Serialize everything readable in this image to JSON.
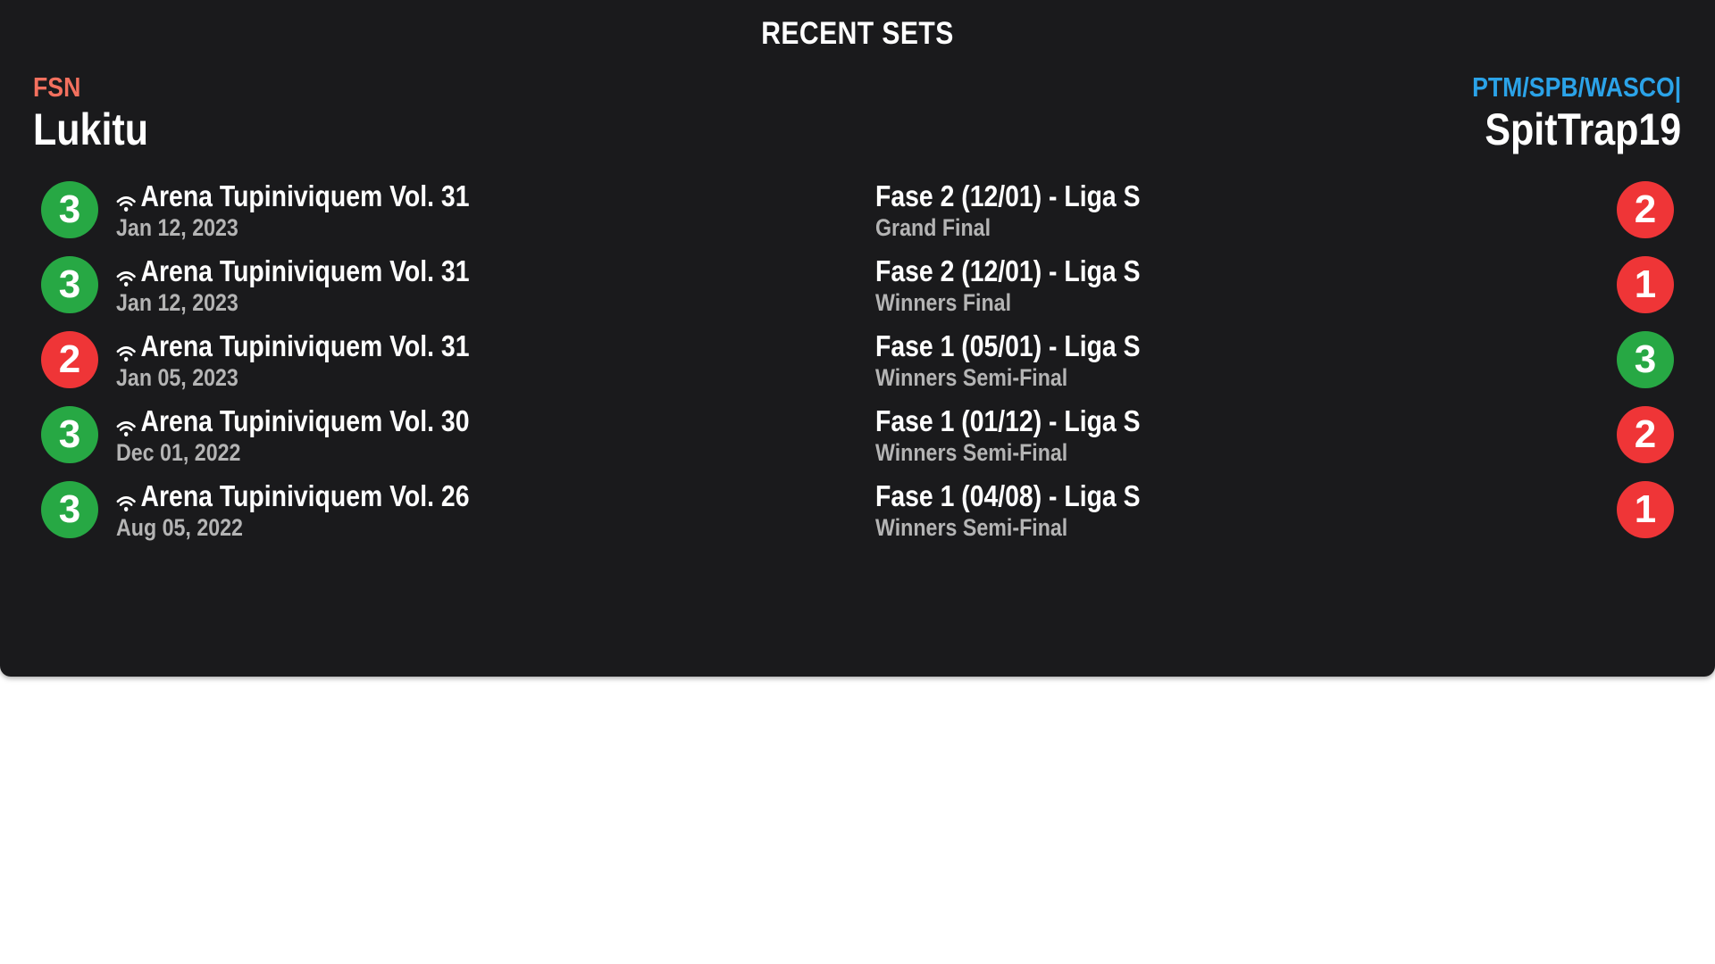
{
  "title": "RECENT SETS",
  "colors": {
    "background": "#1a1a1c",
    "win": "#27a844",
    "loss": "#ef3537",
    "left_sponsor": "#f3705e",
    "right_sponsor": "#2ba3e8",
    "subtext": "#b4b4b4"
  },
  "player_left": {
    "sponsor": "FSN",
    "name": "Lukitu"
  },
  "player_right": {
    "sponsor": "PTM/SPB/WASCO|",
    "name": "SpitTrap19"
  },
  "sets": [
    {
      "left_score": "3",
      "right_score": "2",
      "left_result": "win",
      "right_result": "loss",
      "online_icon": "wifi-icon",
      "tournament": "Arena Tupiniviquem Vol. 31",
      "date": "Jan 12, 2023",
      "event": "Fase 2 (12/01) - Liga S",
      "round": "Grand Final"
    },
    {
      "left_score": "3",
      "right_score": "1",
      "left_result": "win",
      "right_result": "loss",
      "online_icon": "wifi-icon",
      "tournament": "Arena Tupiniviquem Vol. 31",
      "date": "Jan 12, 2023",
      "event": "Fase 2 (12/01) - Liga S",
      "round": "Winners Final"
    },
    {
      "left_score": "2",
      "right_score": "3",
      "left_result": "loss",
      "right_result": "win",
      "online_icon": "wifi-icon",
      "tournament": "Arena Tupiniviquem Vol. 31",
      "date": "Jan 05, 2023",
      "event": "Fase 1 (05/01) - Liga S",
      "round": "Winners Semi-Final"
    },
    {
      "left_score": "3",
      "right_score": "2",
      "left_result": "win",
      "right_result": "loss",
      "online_icon": "wifi-icon",
      "tournament": "Arena Tupiniviquem Vol. 30",
      "date": "Dec 01, 2022",
      "event": "Fase 1 (01/12) - Liga S",
      "round": "Winners Semi-Final"
    },
    {
      "left_score": "3",
      "right_score": "1",
      "left_result": "win",
      "right_result": "loss",
      "online_icon": "wifi-icon",
      "tournament": "Arena Tupiniviquem Vol. 26",
      "date": "Aug 05, 2022",
      "event": "Fase 1 (04/08) - Liga S",
      "round": "Winners Semi-Final"
    }
  ]
}
